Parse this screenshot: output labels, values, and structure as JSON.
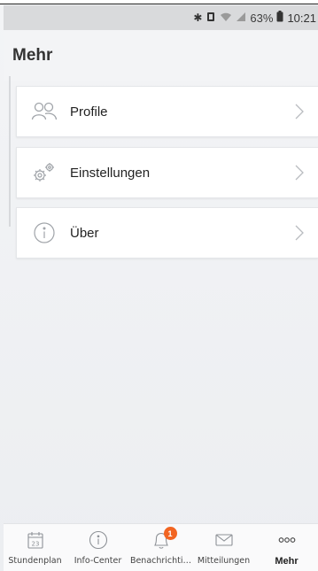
{
  "status_bar": {
    "icons": [
      "bluetooth-icon",
      "vibrate-icon",
      "wifi-icon",
      "signal-icon"
    ],
    "battery_percent": "63%",
    "battery_icon": "battery-icon",
    "time": "10:21"
  },
  "header": {
    "title": "Mehr"
  },
  "menu": {
    "items": [
      {
        "label": "Profile",
        "icon": "users-icon"
      },
      {
        "label": "Einstellungen",
        "icon": "gears-icon"
      },
      {
        "label": "Über",
        "icon": "info-icon"
      }
    ]
  },
  "tabbar": {
    "tabs": [
      {
        "label": "Stundenplan",
        "icon": "calendar-icon",
        "calendar_day": "23"
      },
      {
        "label": "Info-Center",
        "icon": "info-icon"
      },
      {
        "label": "Benachrichti…",
        "icon": "bell-icon",
        "badge": "1"
      },
      {
        "label": "Mitteilungen",
        "icon": "envelope-icon"
      },
      {
        "label": "Mehr",
        "icon": "more-icon",
        "active": true
      }
    ]
  },
  "colors": {
    "accent": "#f26522",
    "background": "#f0f1f3",
    "card": "#ffffff",
    "icon_gray": "#9a9ea3"
  }
}
